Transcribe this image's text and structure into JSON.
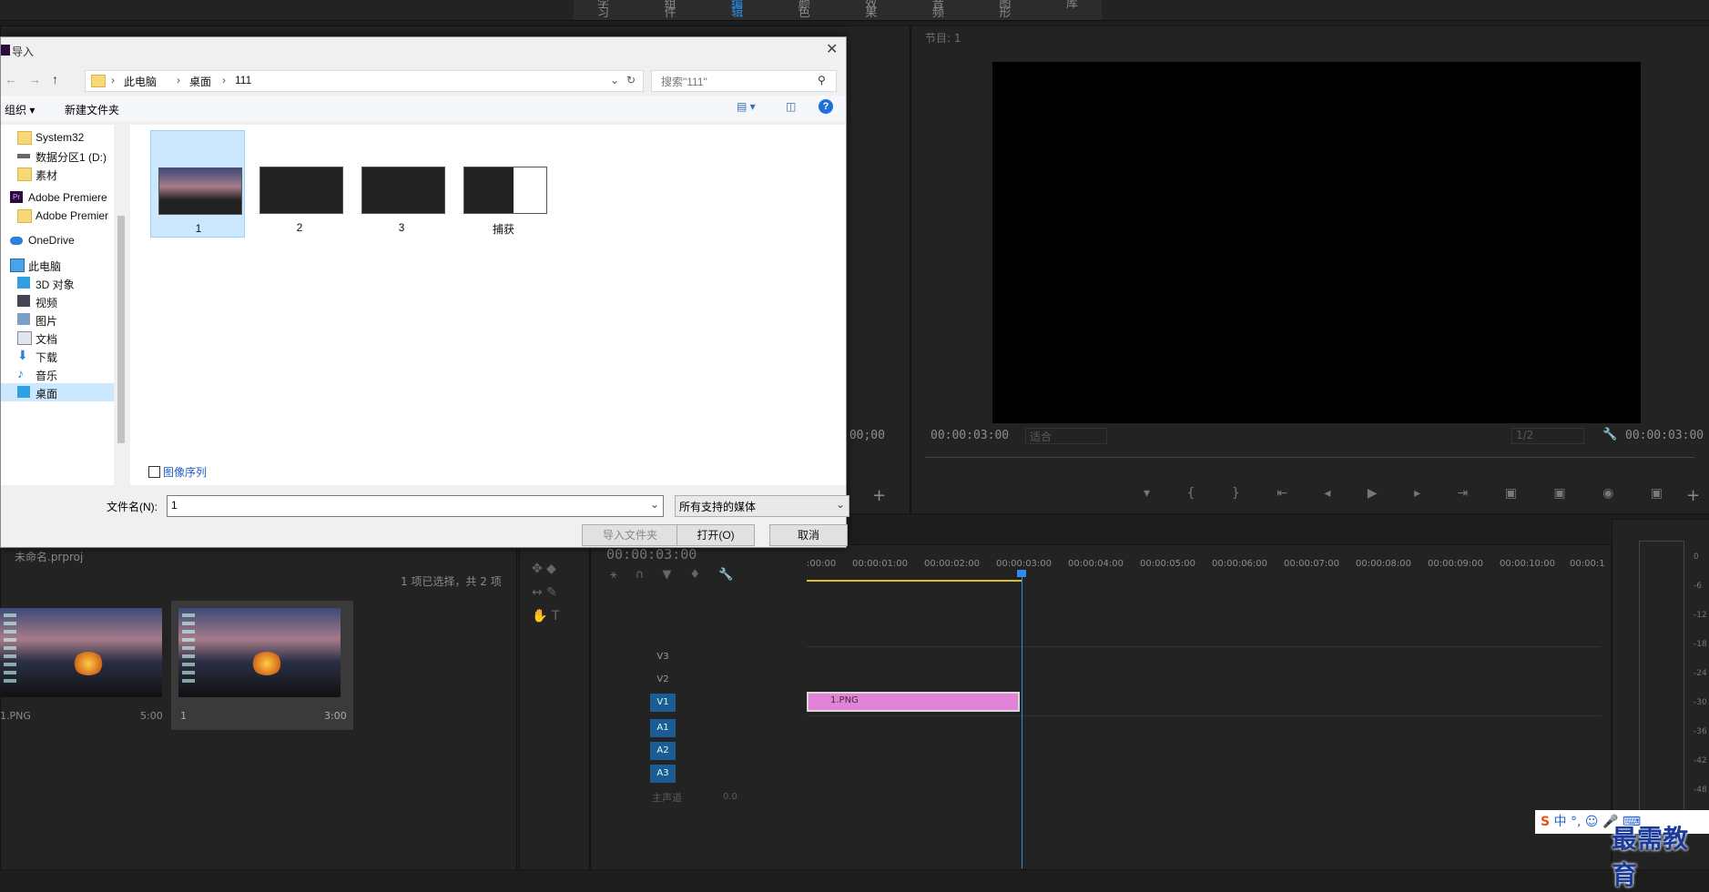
{
  "workspace_tabs": [
    "学习",
    "组件",
    "编辑",
    "颜色",
    "效果",
    "音频",
    "图形",
    "库"
  ],
  "workspace_active": "编辑",
  "program_monitor": {
    "title": "节目: 1",
    "timecode_left": "00:00:03:00",
    "fit": "适合",
    "quality": "1/2",
    "timecode_right": "00:00:03:00"
  },
  "source_timecode": ":00;00",
  "project": {
    "name": "未命名.prproj",
    "selection_status": "1 项已选择，共 2 项",
    "items": [
      {
        "name": "1.PNG",
        "duration": "5:00"
      },
      {
        "name": "1",
        "duration": "3:00"
      }
    ]
  },
  "timeline": {
    "timecode": "00:00:03:00",
    "ruler": [
      ":00:00",
      "00:00:01:00",
      "00:00:02:00",
      "00:00:03:00",
      "00:00:04:00",
      "00:00:05:00",
      "00:00:06:00",
      "00:00:07:00",
      "00:00:08:00",
      "00:00:09:00",
      "00:00:10:00",
      "00:00:1"
    ],
    "video_tracks": [
      "V3",
      "V2",
      "V1"
    ],
    "audio_tracks": [
      "A1",
      "A2",
      "A3"
    ],
    "master": "主声道",
    "master_value": "0.0",
    "clip_name": "1.PNG"
  },
  "audio_meter_ticks": [
    "0",
    "-6",
    "-12",
    "-18",
    "-24",
    "-30",
    "-36",
    "-42",
    "-48"
  ],
  "dialog": {
    "title": "导入",
    "breadcrumb": [
      "此电脑",
      "桌面",
      "111"
    ],
    "search_placeholder": "搜索\"111\"",
    "organize": "组织 ▾",
    "new_folder": "新建文件夹",
    "nav": [
      {
        "label": "System32",
        "icon": "folder-icon"
      },
      {
        "label": "数据分区1 (D:)",
        "icon": "drive-icon"
      },
      {
        "label": "素材",
        "icon": "folder-icon"
      },
      {
        "label": "Adobe Premiere",
        "icon": "premiere-icon"
      },
      {
        "label": "Adobe Premier",
        "icon": "folder-icon"
      },
      {
        "label": "OneDrive",
        "icon": "cloud-icon"
      },
      {
        "label": "此电脑",
        "icon": "computer-icon"
      },
      {
        "label": "3D 对象",
        "icon": "cube-icon"
      },
      {
        "label": "视频",
        "icon": "video-icon"
      },
      {
        "label": "图片",
        "icon": "picture-icon"
      },
      {
        "label": "文档",
        "icon": "document-icon"
      },
      {
        "label": "下载",
        "icon": "download-icon"
      },
      {
        "label": "音乐",
        "icon": "music-icon"
      },
      {
        "label": "桌面",
        "icon": "desktop-icon"
      }
    ],
    "files": [
      "1",
      "2",
      "3",
      "捕获"
    ],
    "image_sequence": "图像序列",
    "filename_label": "文件名(N):",
    "filename_value": "1",
    "filetype": "所有支持的媒体",
    "import_folder": "导入文件夹",
    "open": "打开(O)",
    "cancel": "取消"
  },
  "ime_bar": "中 °, ☺ 🎤 ⌨",
  "watermark": "最需教育"
}
